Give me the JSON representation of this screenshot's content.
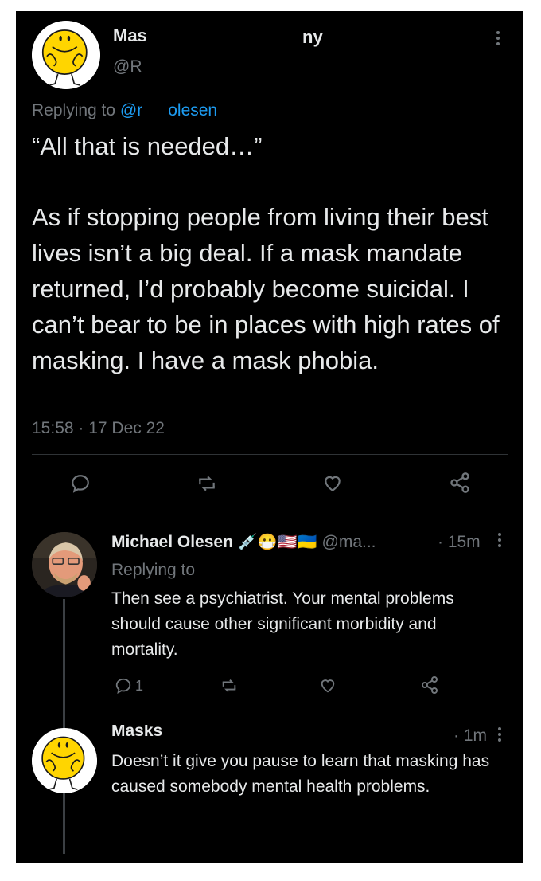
{
  "main_tweet": {
    "display_name": "Mas",
    "display_name_tail": "ny",
    "handle": "@Ra",
    "replying_label": "Replying to",
    "replying_mention": "@r",
    "replying_mention_tail": "olesen",
    "quote": "“All that is needed…”",
    "body": "As if stopping people from living their best lives isn’t a big deal. If a mask mandate returned, I’d probably become suicidal. I can’t bear to be in places with high rates of masking. I have a mask phobia.",
    "timestamp": "15:58 · 17 Dec 22"
  },
  "reply_1": {
    "display_name": "Michael Olesen",
    "emojis": "💉😷🇺🇸🇺🇦",
    "handle": "@ma...",
    "time": "· 15m",
    "replying_label": "Replying to",
    "body": "Then see a psychiatrist. Your mental problems should cause other significant morbidity and mortality.",
    "reply_count": "1"
  },
  "reply_2": {
    "display_name": "Masks",
    "time": "· 1m",
    "body": "Doesn’t it give you pause to learn that masking has caused somebody mental health problems."
  },
  "colors": {
    "background": "#000000",
    "text": "#e7e9ea",
    "secondary": "#71767b",
    "link": "#1d9bf0",
    "divider": "#2f3336"
  }
}
